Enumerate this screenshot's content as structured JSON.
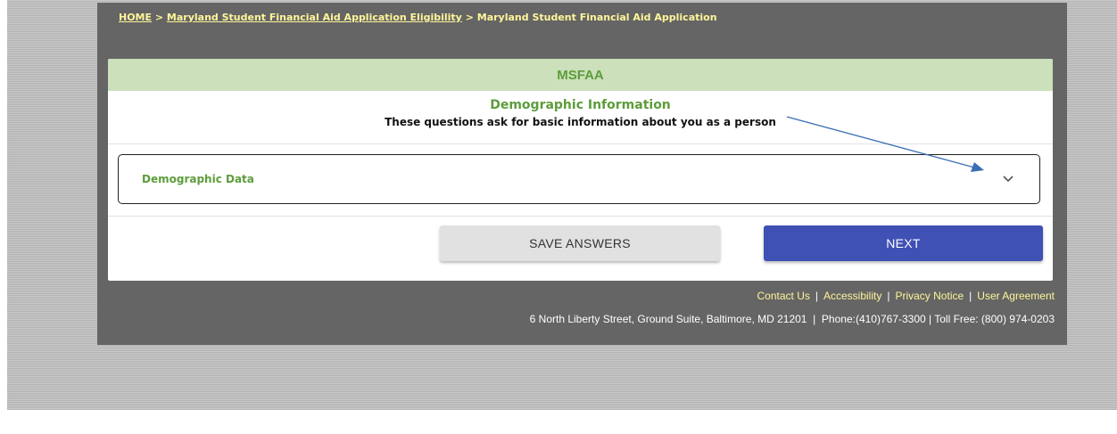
{
  "breadcrumb": {
    "home": "HOME",
    "sep1": " > ",
    "eligibility": "Maryland Student Financial Aid Application Eligibility",
    "sep2": " > ",
    "current": "Maryland Student Financial Aid Application"
  },
  "card": {
    "header": "MSFAA",
    "section_title": "Demographic Information",
    "section_subtitle": "These questions ask for basic information about you as a person",
    "accordion_label": "Demographic Data",
    "accordion_icon": "chevron-down-icon"
  },
  "buttons": {
    "save": "SAVE ANSWERS",
    "next": "NEXT"
  },
  "footer": {
    "links": [
      "Contact Us",
      "Accessibility",
      "Privacy Notice",
      "User Agreement"
    ],
    "separator": "|",
    "address": "6 North Liberty Street, Ground Suite, Baltimore, MD 21201  |  Phone:(410)767-3300 | Toll Free: (800) 974-0203"
  },
  "colors": {
    "panel_bg": "#656565",
    "link_yellow": "#fff59a",
    "header_green_bg": "#cbe0bb",
    "title_green": "#5d9c3b",
    "next_button": "#3f51b5",
    "save_button": "#e1e1e1",
    "annotation_arrow": "#3b6fb5"
  }
}
